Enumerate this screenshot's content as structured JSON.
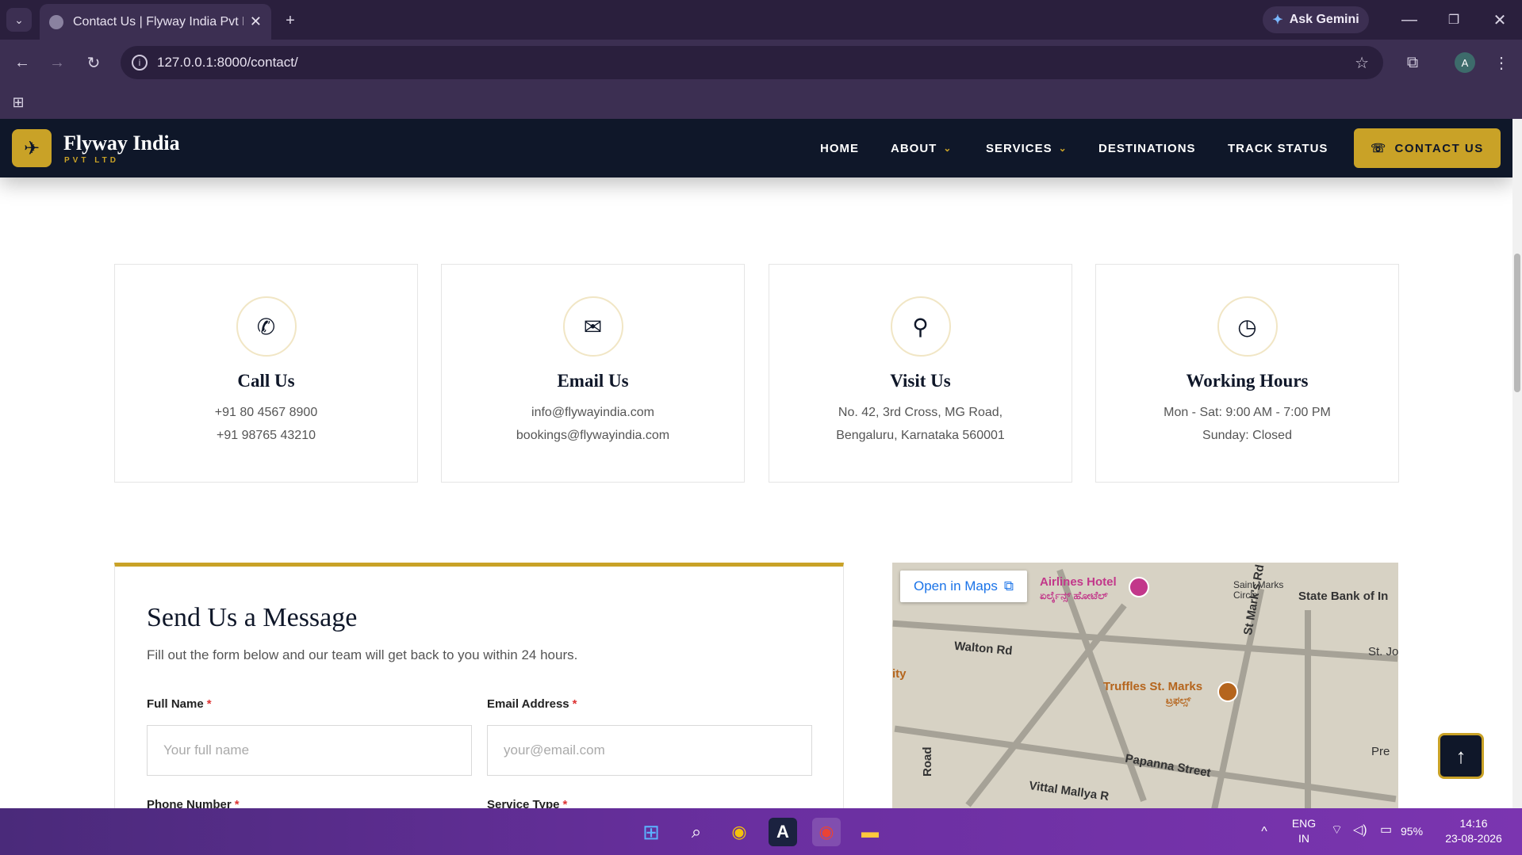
{
  "browser": {
    "tab_title": "Contact Us | Flyway India Pvt Ltd",
    "url": "127.0.0.1:8000/contact/",
    "gemini_label": "Ask Gemini",
    "profile_initial": "A"
  },
  "nav": {
    "brand": "Flyway India",
    "brand_sub": "PVT LTD",
    "items": [
      {
        "label": "HOME"
      },
      {
        "label": "ABOUT"
      },
      {
        "label": "SERVICES"
      },
      {
        "label": "DESTINATIONS"
      },
      {
        "label": "TRACK STATUS"
      }
    ],
    "cta": "CONTACT US"
  },
  "cards": [
    {
      "icon": "phone-icon",
      "title": "Call Us",
      "line1": "+91 80 4567 8900",
      "line2": "+91 98765 43210"
    },
    {
      "icon": "envelope-icon",
      "title": "Email Us",
      "line1": "info@flywayindia.com",
      "line2": "bookings@flywayindia.com"
    },
    {
      "icon": "map-pin-icon",
      "title": "Visit Us",
      "line1": "No. 42, 3rd Cross, MG Road,",
      "line2": "Bengaluru, Karnataka 560001"
    },
    {
      "icon": "clock-icon",
      "title": "Working Hours",
      "line1": "Mon - Sat: 9:00 AM - 7:00 PM",
      "line2": "Sunday: Closed"
    }
  ],
  "form": {
    "title": "Send Us a Message",
    "subtitle": "Fill out the form below and our team will get back to you within 24 hours.",
    "full_name_label": "Full Name",
    "full_name_placeholder": "Your full name",
    "email_label": "Email Address",
    "email_placeholder": "your@email.com",
    "phone_label": "Phone Number",
    "service_label": "Service Type",
    "required_mark": "*"
  },
  "map": {
    "open_label": "Open in Maps",
    "places": [
      "Airlines Hotel",
      "ಏರ್ಲೈನ್ಸ್ ಹೋಟೆಲ್",
      "Walton Rd",
      "Truffles St. Marks",
      "ಟ್ರಫಲ್ಸ್",
      "St Mark's Rd",
      "Papanna Street",
      "Vittal Mallya R",
      "Saint Marks Circle",
      "State Bank of In",
      "St. Jos",
      "Pre",
      "ity",
      "Road"
    ]
  },
  "taskbar": {
    "lang_top": "ENG",
    "lang_bottom": "IN",
    "battery": "95%",
    "time": "14:16",
    "date": "23-08-2026"
  },
  "colors": {
    "navy": "#0f1729",
    "gold": "#c9a227",
    "chrome": "#2a1f3d"
  }
}
